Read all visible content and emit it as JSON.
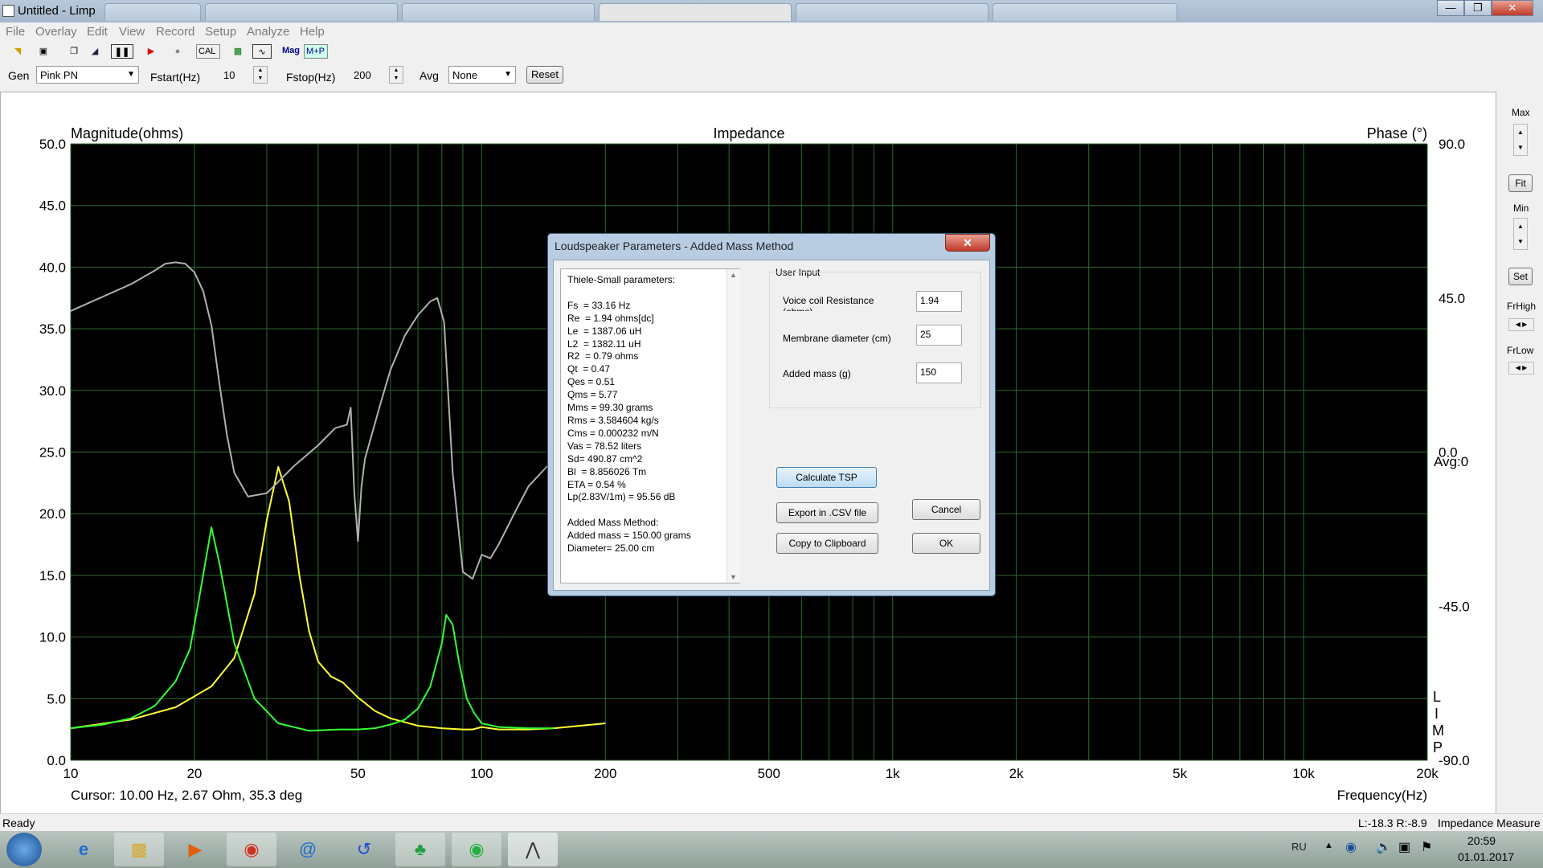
{
  "window": {
    "title": "Untitled - Limp",
    "browser_tabs": [
      "",
      "",
      "",
      "",
      "",
      ""
    ],
    "buttons": {
      "minimize": "—",
      "maximize": "❐",
      "close": "✕"
    }
  },
  "menu": [
    "File",
    "Overlay",
    "Edit",
    "View",
    "Record",
    "Setup",
    "Analyze",
    "Help"
  ],
  "toolbar": {
    "cal": "CAL",
    "mag": "Mag",
    "mp": "M+P"
  },
  "controls": {
    "gen_label": "Gen",
    "gen_value": "Pink PN",
    "fstart_label": "Fstart(Hz)",
    "fstart_value": "10",
    "fstop_label": "Fstop(Hz)",
    "fstop_value": "200",
    "avg_label": "Avg",
    "avg_value": "None",
    "reset": "Reset"
  },
  "chart_data": {
    "type": "line",
    "title": "Impedance",
    "ylabel": "Magnitude(ohms)",
    "y2label": "Phase (°)",
    "xlabel": "Frequency(Hz)",
    "xscale": "log",
    "xlim": [
      10,
      20000
    ],
    "ylim": [
      0,
      50
    ],
    "y2lim": [
      -90,
      90
    ],
    "background": "#000000",
    "grid": true,
    "yticks": [
      "50.0",
      "45.0",
      "40.0",
      "35.0",
      "30.0",
      "25.0",
      "20.0",
      "15.0",
      "10.0",
      "5.0",
      "0.0"
    ],
    "y2ticks": [
      "90.0",
      "45.0",
      "0.0",
      "-45.0",
      "-90.0"
    ],
    "xticks": [
      {
        "v": 10,
        "label": "10"
      },
      {
        "v": 20,
        "label": "20"
      },
      {
        "v": 50,
        "label": "50"
      },
      {
        "v": 100,
        "label": "100"
      },
      {
        "v": 200,
        "label": "200"
      },
      {
        "v": 500,
        "label": "500"
      },
      {
        "v": 1000,
        "label": "1k"
      },
      {
        "v": 2000,
        "label": "2k"
      },
      {
        "v": 5000,
        "label": "5k"
      },
      {
        "v": 10000,
        "label": "10k"
      },
      {
        "v": 20000,
        "label": "20k"
      }
    ],
    "series": [
      {
        "color": "#ffff33",
        "axis": "y",
        "x": [
          10,
          14,
          18,
          22,
          25,
          28,
          30,
          32,
          34,
          36,
          38,
          40,
          43,
          46,
          50,
          55,
          60,
          70,
          80,
          90,
          95,
          100,
          110,
          130,
          150,
          200
        ],
        "y": [
          2.6,
          3.3,
          4.3,
          6.0,
          8.3,
          13.5,
          19.5,
          23.8,
          21.0,
          15.0,
          10.5,
          8.0,
          6.8,
          6.3,
          5.1,
          4.0,
          3.4,
          2.8,
          2.6,
          2.5,
          2.5,
          2.7,
          2.5,
          2.5,
          2.6,
          3.0
        ]
      },
      {
        "color": "#33ff33",
        "axis": "y",
        "x": [
          10,
          12,
          14,
          16,
          18,
          19.5,
          20.5,
          22,
          23,
          25,
          28,
          32,
          38,
          45,
          50,
          55,
          60,
          65,
          70,
          75,
          80,
          82,
          85,
          88,
          92,
          96,
          100,
          110,
          130,
          150
        ],
        "y": [
          2.6,
          2.9,
          3.4,
          4.4,
          6.4,
          9.0,
          13.0,
          18.9,
          16.0,
          9.5,
          5.0,
          3.0,
          2.4,
          2.5,
          2.5,
          2.6,
          2.9,
          3.3,
          4.2,
          6.0,
          9.5,
          11.8,
          11.0,
          8.0,
          5.0,
          3.8,
          3.0,
          2.7,
          2.6,
          2.6
        ]
      },
      {
        "color": "#b0b0b0",
        "axis": "y2",
        "x": [
          10,
          14,
          16,
          17,
          18,
          19,
          20,
          21,
          22,
          23,
          24,
          25,
          27,
          30,
          35,
          40,
          44,
          47,
          48,
          49,
          50,
          51,
          52,
          54,
          57,
          60,
          65,
          70,
          75,
          78,
          81,
          85,
          90,
          95,
          100,
          105,
          110,
          120,
          130,
          150
        ],
        "y": [
          41.2,
          49,
          53,
          55,
          55.4,
          55,
          52.5,
          47,
          37,
          20,
          5,
          -6,
          -13,
          -12,
          -4,
          2,
          7,
          8,
          13,
          -12,
          -26,
          -10,
          -2,
          5,
          15,
          24,
          34,
          40,
          44,
          45,
          38,
          -6,
          -35,
          -37,
          -30,
          -31,
          -27,
          -18,
          -10,
          -2
        ]
      }
    ]
  },
  "plot_overlays": {
    "cursor_readout": "Cursor: 10.00 Hz, 2.67 Ohm, 35.3 deg",
    "avg_readout": "Avg:0",
    "limp_vertical": [
      "L",
      "I",
      "M",
      "P"
    ]
  },
  "right_panel": {
    "max": "Max",
    "fit": "Fit",
    "min": "Min",
    "set": "Set",
    "frhigh": "FrHigh",
    "frlow": "FrLow"
  },
  "status": {
    "left": "Ready",
    "levels": "L:-18.3 R:-8.9",
    "mode": "Impedance Measure"
  },
  "taskbar": {
    "lang": "RU",
    "time": "20:59",
    "date": "01.01.2017"
  },
  "dialog": {
    "title": "Loudspeaker Parameters - Added Mass Method",
    "close": "✕",
    "tsp_lines": [
      "Thiele-Small parameters:",
      "",
      "Fs  = 33.16 Hz",
      "Re  = 1.94 ohms[dc]",
      "Le  = 1387.06 uH",
      "L2  = 1382.11 uH",
      "R2  = 0.79 ohms",
      "Qt  = 0.47",
      "Qes = 0.51",
      "Qms = 5.77",
      "Mms = 99.30 grams",
      "Rms = 3.584604 kg/s",
      "Cms = 0.000232 m/N",
      "Vas = 78.52 liters",
      "Sd= 490.87 cm^2",
      "Bl  = 8.856026 Tm",
      "ETA = 0.54 %",
      "Lp(2.83V/1m) = 95.56 dB",
      "",
      "Added Mass Method:",
      "Added mass = 150.00 grams",
      "Diameter= 25.00 cm"
    ],
    "user_input_label": "User Input",
    "vcr_label": "Voice coil Resistance",
    "vcr_label2": "(ohms)",
    "vcr_value": "1.94",
    "diam_label": "Membrane diameter (cm)",
    "diam_value": "25",
    "mass_label": "Added mass (g)",
    "mass_value": "150",
    "calc": "Calculate TSP",
    "export": "Export in .CSV file",
    "clipboard": "Copy to Clipboard",
    "cancel": "Cancel",
    "ok": "OK"
  }
}
